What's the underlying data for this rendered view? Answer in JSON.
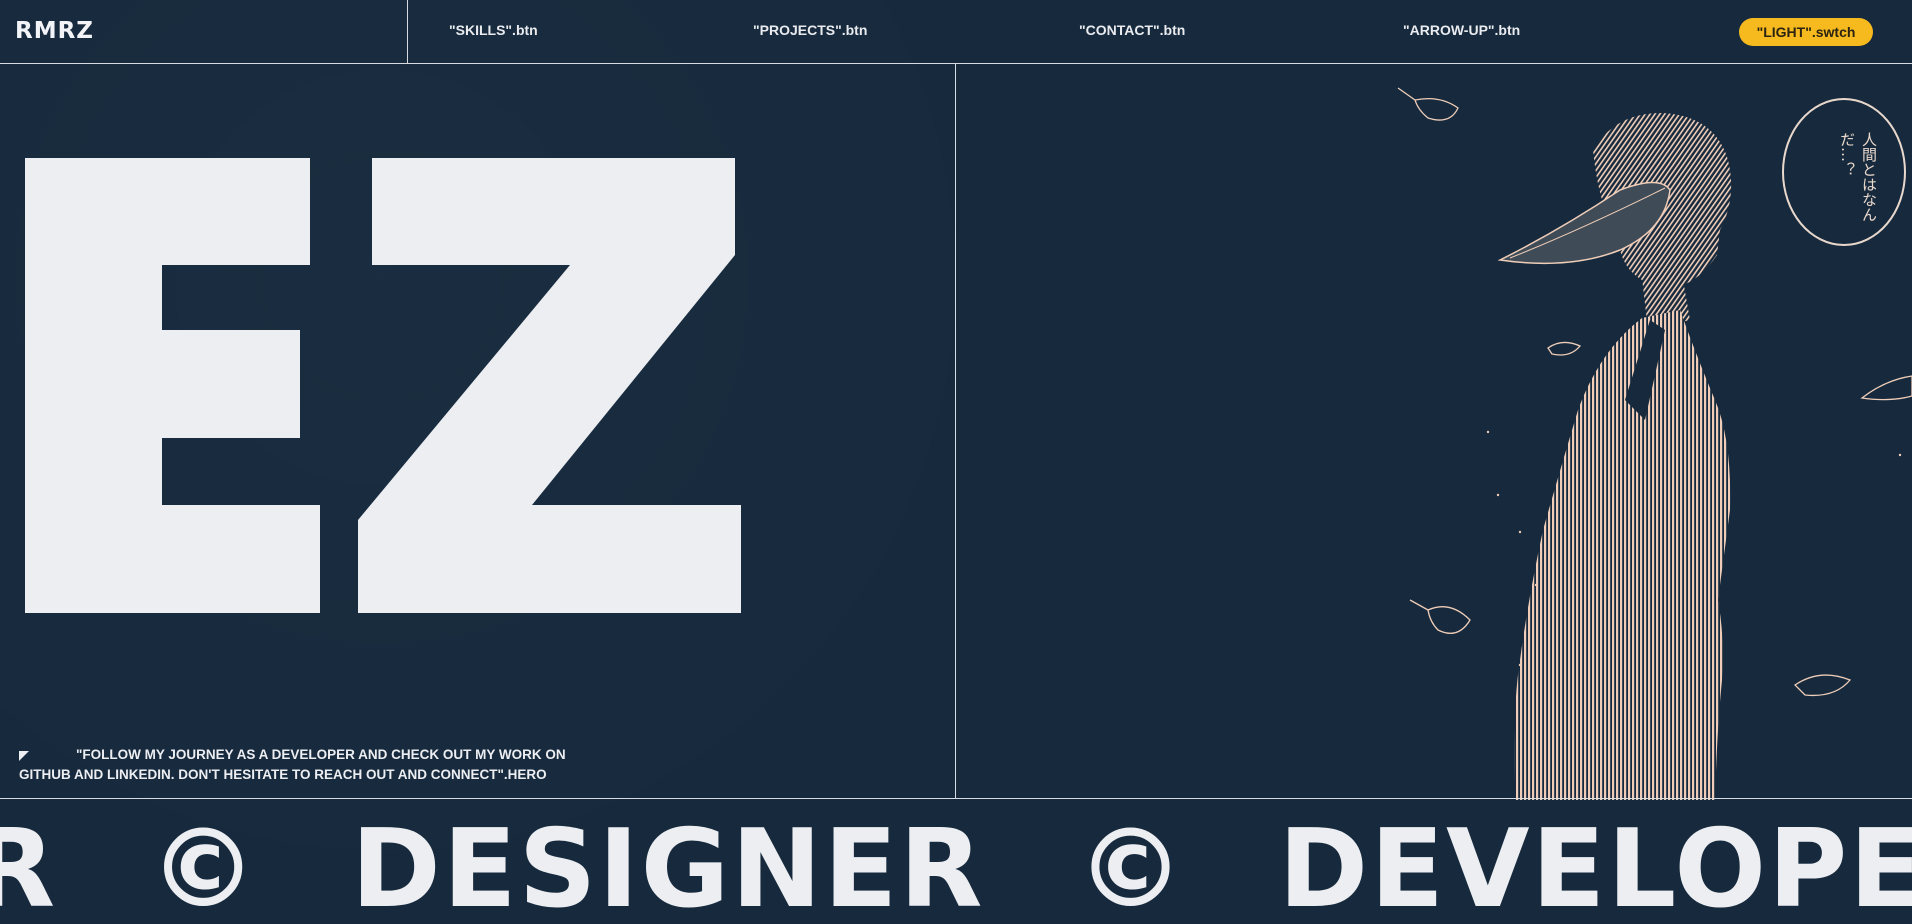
{
  "header": {
    "logo": "RMRZ",
    "nav": {
      "skills": "\"SKILLS\".btn",
      "projects": "\"PROJECTS\".btn",
      "contact": "\"CONTACT\".btn",
      "arrow_up": "\"ARROW-UP\".btn"
    },
    "switch_label": "\"LIGHT\".swtch"
  },
  "hero": {
    "letters": "EZ",
    "text": "\"FOLLOW MY JOURNEY AS A DEVELOPER AND CHECK OUT MY WORK ON GITHUB AND LINKEDIN. DON'T HESITATE TO REACH OUT AND CONNECT\".hero"
  },
  "speech_bubble": {
    "text": "人間とはなんだ…？"
  },
  "marquee": {
    "item1": "R",
    "sep1": "©",
    "item2": "DESIGNER",
    "sep2": "©",
    "item3": "DEVELOPER"
  },
  "colors": {
    "background": "#172a3d",
    "text": "#eceef2",
    "accent": "#f6b91e",
    "illustration": "#efcdb8"
  },
  "icons": {
    "hero_arrow": "corner-arrow-icon"
  }
}
